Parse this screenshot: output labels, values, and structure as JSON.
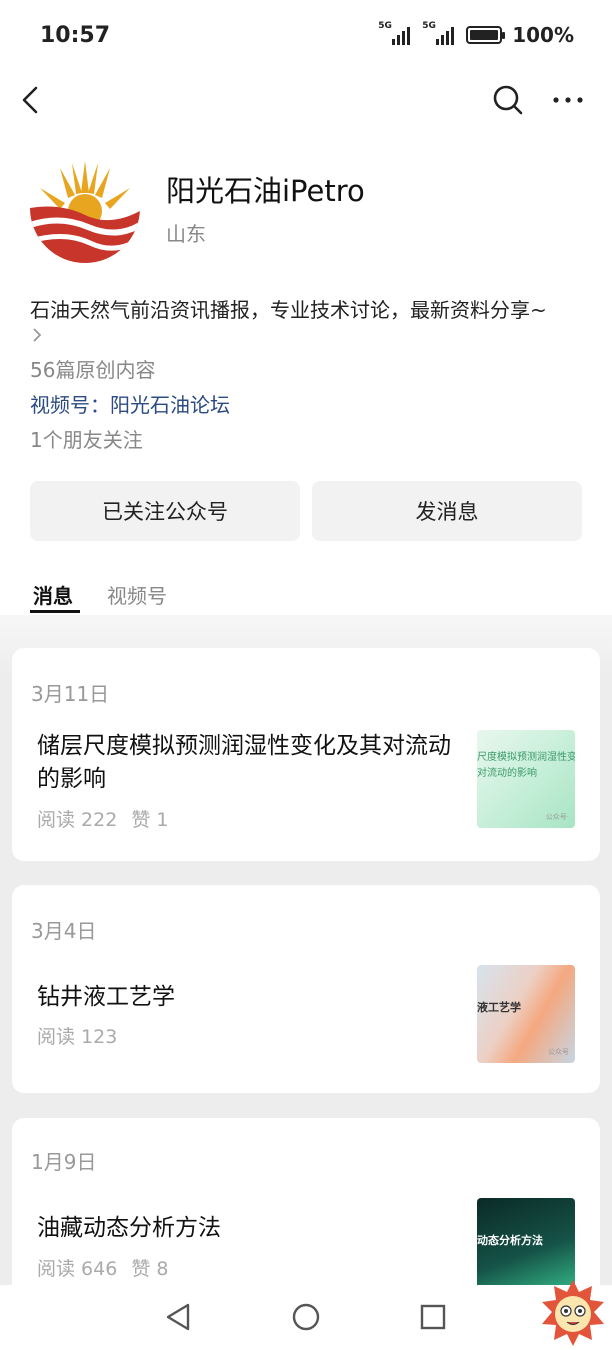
{
  "status": {
    "time": "10:57",
    "signal1": "5G",
    "signal2": "5G",
    "battery": "100%"
  },
  "profile": {
    "name": "阳光石油iPetro",
    "region": "山东",
    "description": "石油天然气前沿资讯播报，专业技术讨论，最新资料分享~",
    "original_count": "56篇原创内容",
    "video_channel": "视频号：阳光石油论坛",
    "friends_following": "1个朋友关注"
  },
  "buttons": {
    "follow": "已关注公众号",
    "message": "发消息"
  },
  "tabs": [
    {
      "label": "消息"
    },
    {
      "label": "视频号"
    }
  ],
  "articles": [
    {
      "date": "3月11日",
      "title": "储层尺度模拟预测润湿性变化及其对流动的影响",
      "reads": "阅读 222",
      "likes": "赞 1",
      "thumb_text_1": "尺度模拟预测润湿性变",
      "thumb_text_2": "对流动的影响",
      "thumb_watermark": "公众号·"
    },
    {
      "date": "3月4日",
      "title": "钻井液工艺学",
      "reads": "阅读 123",
      "thumb_text_1": "液工艺学",
      "thumb_watermark": "公众号"
    },
    {
      "date": "1月9日",
      "title": "油藏动态分析方法",
      "reads": "阅读 646",
      "likes": "赞 8",
      "thumb_text_1": "动态分析方法"
    }
  ],
  "colors": {
    "link": "#2c4b82",
    "logo_red": "#c8352a",
    "logo_gold": "#e8a520"
  }
}
